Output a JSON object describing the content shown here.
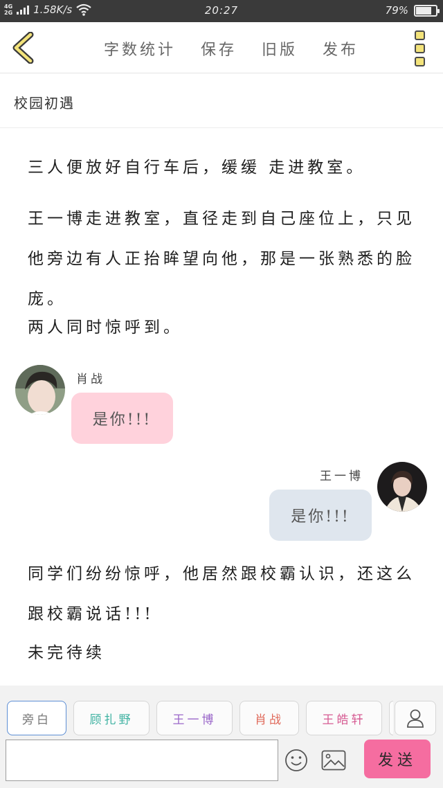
{
  "status_bar": {
    "net_types": [
      "4G",
      "2G"
    ],
    "speed": "1.58K/s",
    "time": "20:27",
    "battery": "79%",
    "battery_level": 0.79
  },
  "toolbar": {
    "actions": [
      "字数统计",
      "保存",
      "旧版",
      "发布"
    ]
  },
  "story": {
    "title": "校园初遇",
    "paragraphs": [
      "三人便放好自行车后，缓缓 走进教室。",
      "王一博走进教室，直径走到自己座位上，只见他旁边有人正抬眸望向他，那是一张熟悉的脸庞。",
      "两人同时惊呼到。"
    ],
    "messages": [
      {
        "speaker": "肖战",
        "text": "是你!!!",
        "bubble_color": "#ffd2dc"
      },
      {
        "speaker": "王一博",
        "text": "是你!!!",
        "bubble_color": "#dfe6ee"
      }
    ],
    "after": [
      "同学们纷纷惊呼，他居然跟校霸认识，还这么跟校霸说话!!!",
      "未完待续"
    ]
  },
  "composer": {
    "roles": [
      {
        "label": "旁白",
        "color": "#777777"
      },
      {
        "label": "顾扎野",
        "color": "#3fb2a2"
      },
      {
        "label": "王一博",
        "color": "#9a66c9"
      },
      {
        "label": "肖战",
        "color": "#e0695a"
      },
      {
        "label": "王皓轩",
        "color": "#d65a92"
      }
    ],
    "input_value": "",
    "send_label": "发送",
    "accent": "#f56da0"
  }
}
